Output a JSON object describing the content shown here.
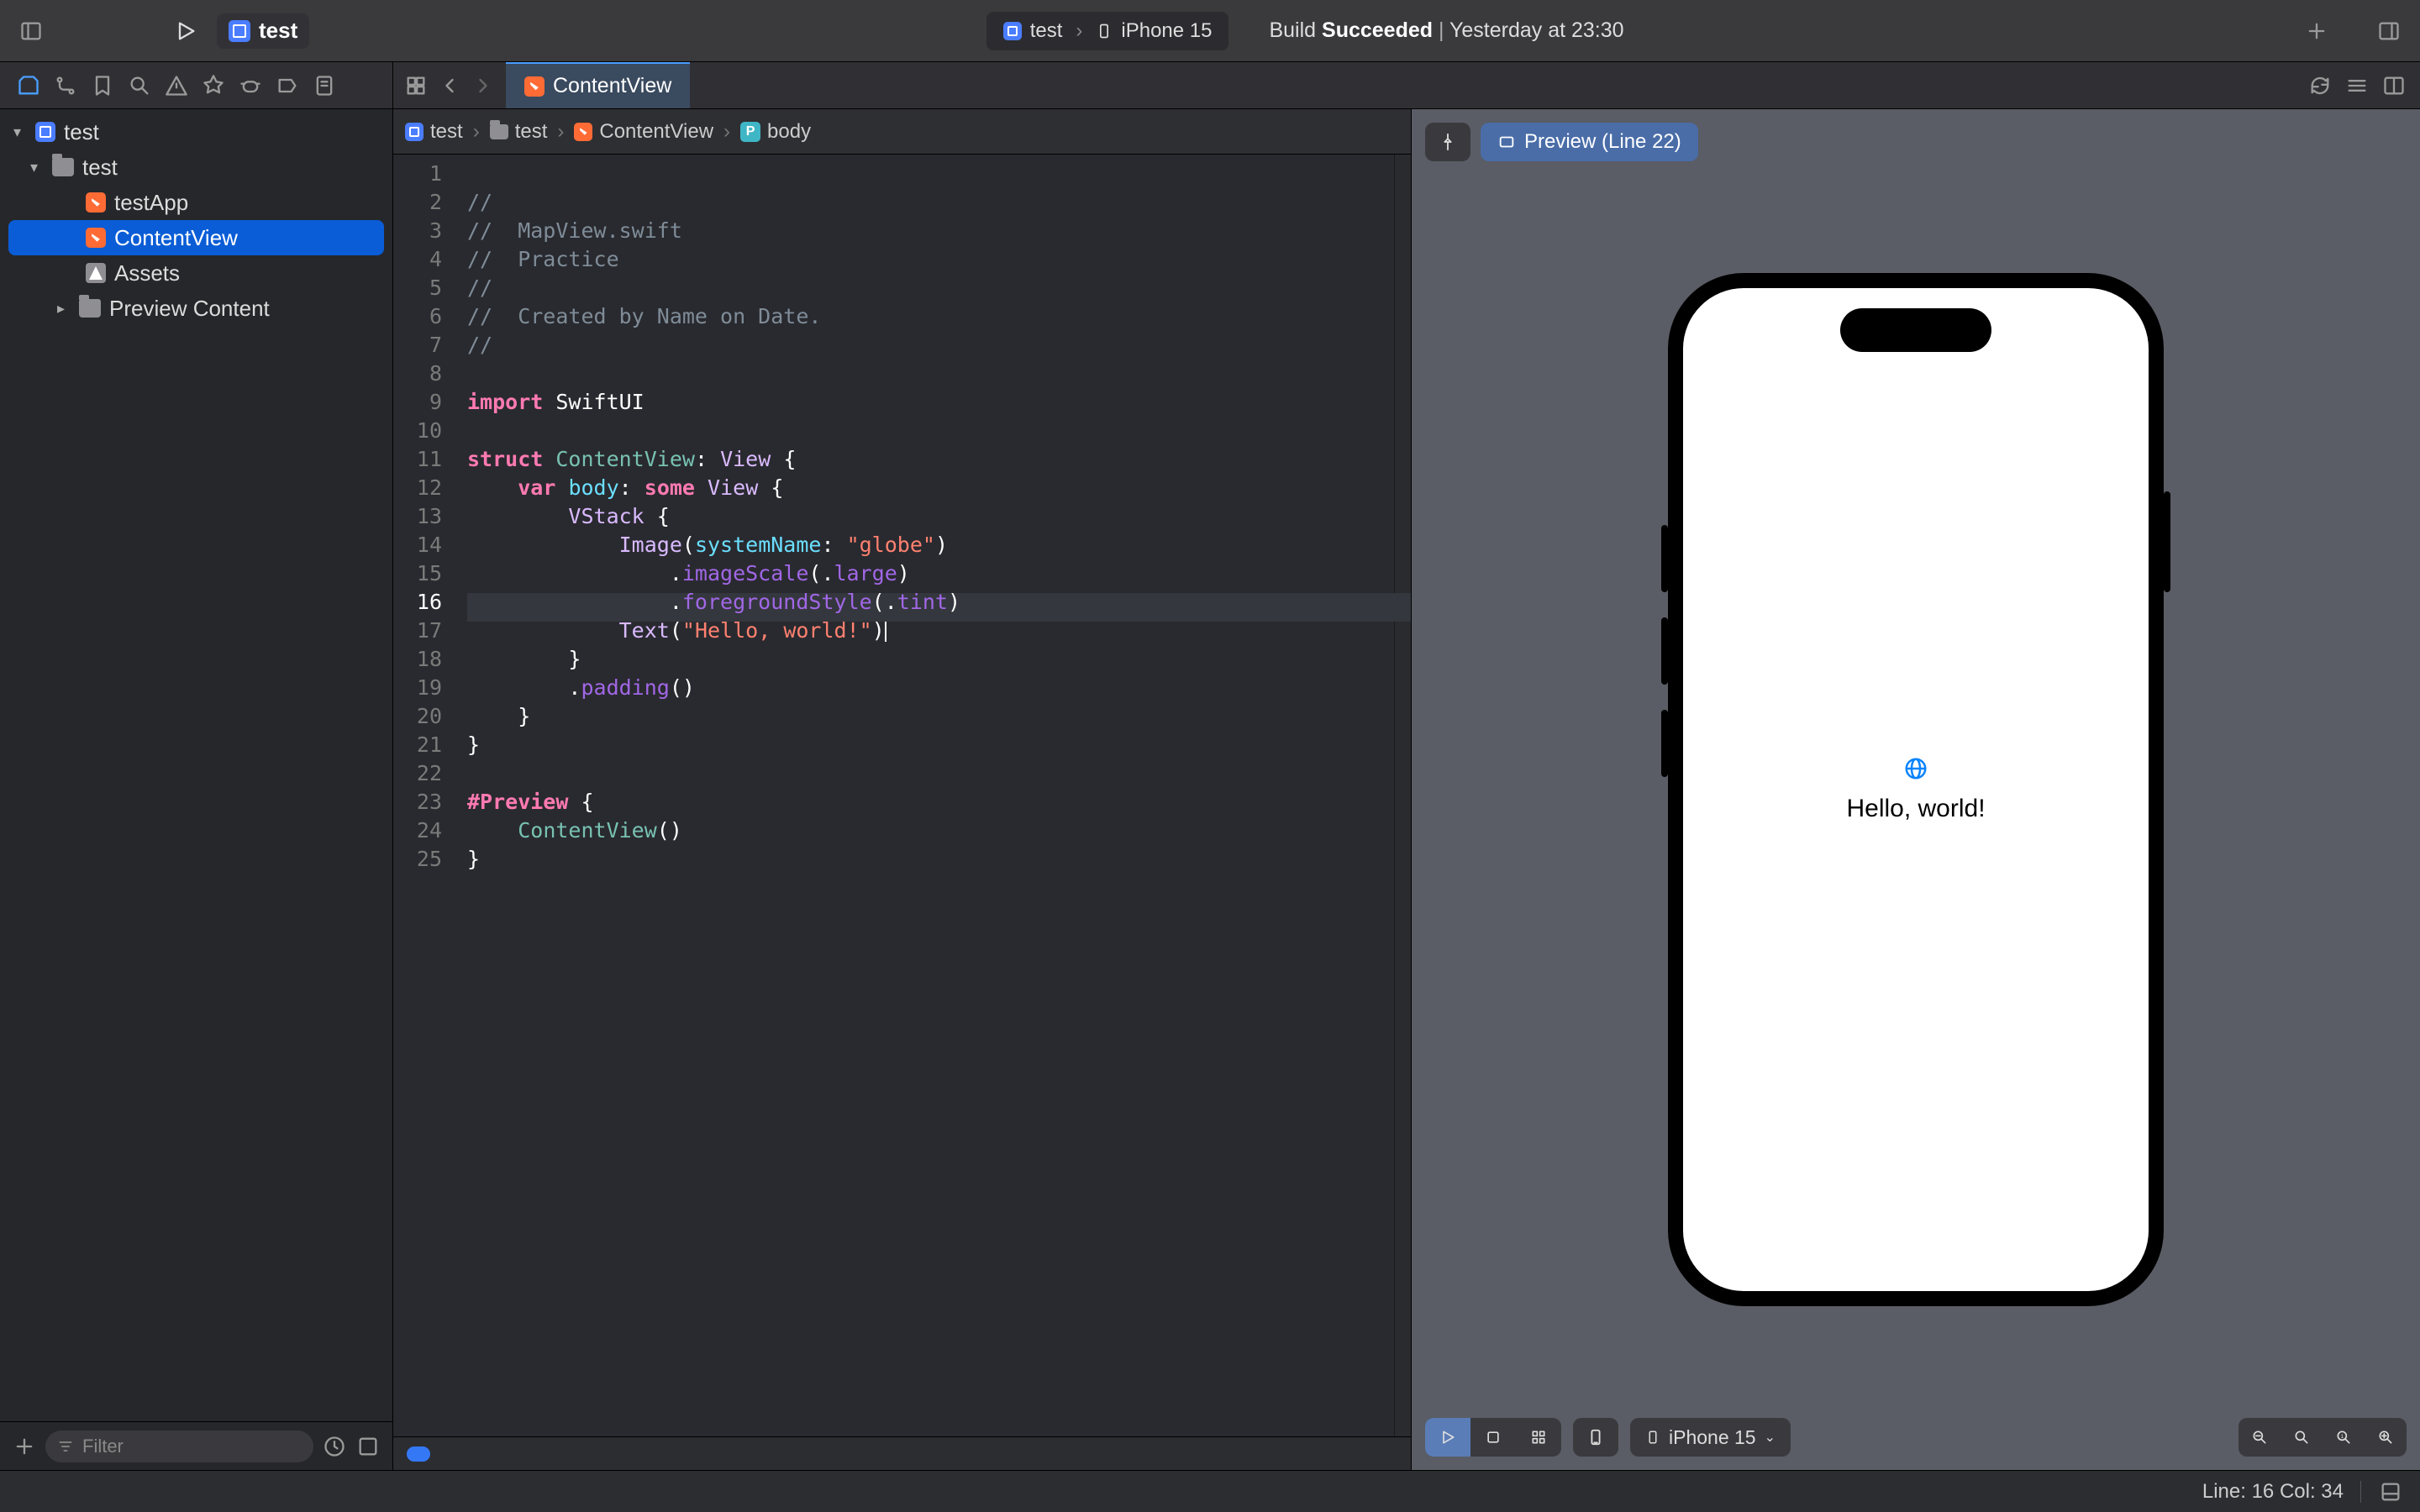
{
  "titlebar": {
    "project": "test",
    "scheme_target": "test",
    "scheme_device": "iPhone 15",
    "build_label": "Build",
    "build_result": "Succeeded",
    "build_time": "Yesterday at 23:30"
  },
  "tabs": {
    "active": "ContentView"
  },
  "jumpbar": {
    "c0": "test",
    "c1": "test",
    "c2": "ContentView",
    "c3": "body"
  },
  "navigator": {
    "root": "test",
    "folder": "test",
    "items": [
      "testApp",
      "ContentView",
      "Assets",
      "Preview Content"
    ],
    "filter_placeholder": "Filter"
  },
  "preview": {
    "chip": "Preview (Line 22)",
    "hello": "Hello, world!",
    "device": "iPhone 15"
  },
  "status": {
    "line_col": "Line: 16  Col: 34"
  },
  "code": {
    "lines": [
      "//",
      "//  MapView.swift",
      "//  Practice",
      "//",
      "//  Created by Name on Date.",
      "//",
      "",
      "import SwiftUI",
      "",
      "struct ContentView: View {",
      "    var body: some View {",
      "        VStack {",
      "            Image(systemName: \"globe\")",
      "                .imageScale(.large)",
      "                .foregroundStyle(.tint)",
      "            Text(\"Hello, world!\")",
      "        }",
      "        .padding()",
      "    }",
      "}",
      "",
      "#Preview {",
      "    ContentView()",
      "}",
      ""
    ],
    "highlight_line": 16
  }
}
